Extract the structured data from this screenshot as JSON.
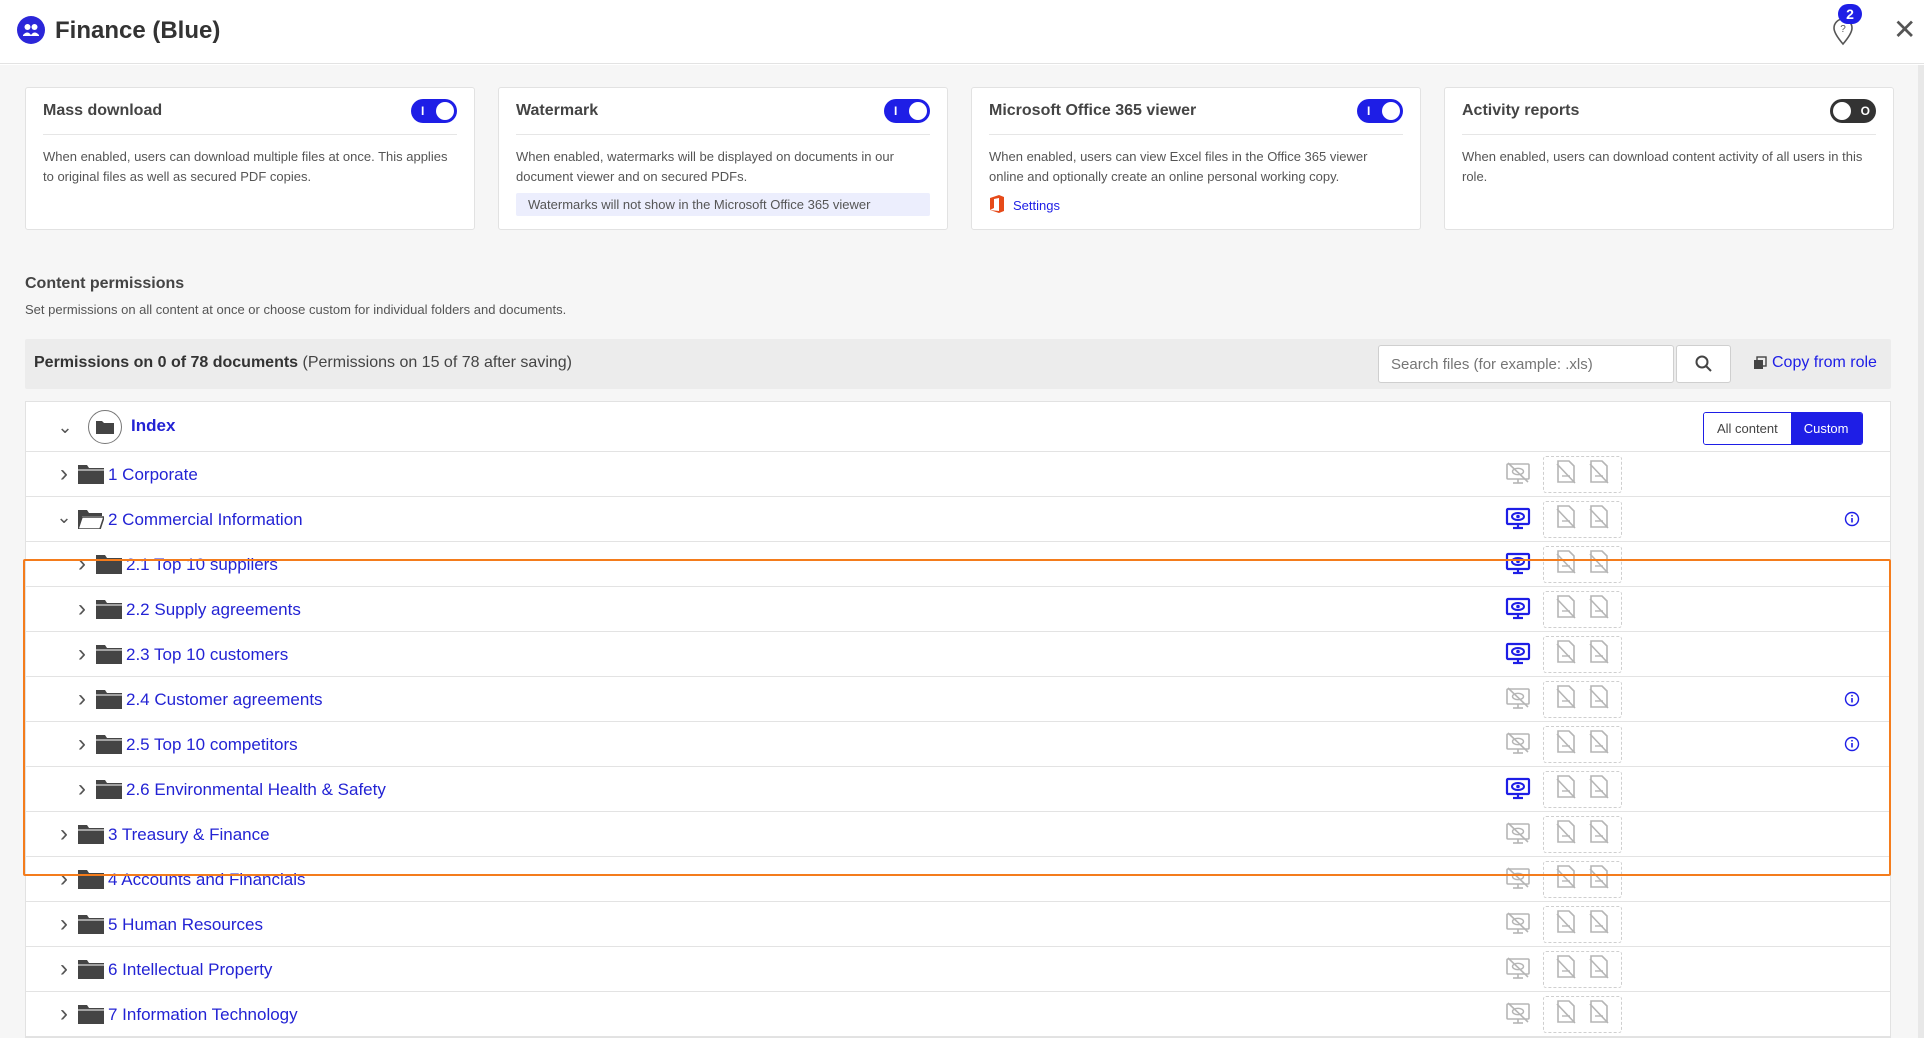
{
  "header": {
    "title": "Finance (Blue)",
    "help_badge": "2",
    "help_icon": "location-help-icon",
    "close_icon": "close-icon"
  },
  "cards": [
    {
      "title": "Mass download",
      "toggle": "on",
      "toggle_mark": "I",
      "description": "When enabled, users can download multiple files at once. This applies to original files as well as secured PDF copies."
    },
    {
      "title": "Watermark",
      "toggle": "on",
      "toggle_mark": "I",
      "description": "When enabled, watermarks will be displayed on documents in our document viewer and on secured PDFs.",
      "note": "Watermarks will not show in the Microsoft Office 365 viewer"
    },
    {
      "title": "Microsoft Office 365 viewer",
      "toggle": "on",
      "toggle_mark": "I",
      "description": "When enabled, users can view Excel files in the Office 365 viewer online and optionally create an online personal working copy.",
      "settings_label": "Settings"
    },
    {
      "title": "Activity reports",
      "toggle": "off",
      "toggle_mark": "O",
      "description": "When enabled, users can download content activity of all users in this role."
    }
  ],
  "content_permissions": {
    "title": "Content permissions",
    "subtitle": "Set permissions on all content at once or choose custom for individual folders and documents.",
    "count_bold": "Permissions on 0 of 78 documents",
    "count_rest": "(Permissions on 15 of 78 after saving)",
    "search_placeholder": "Search files (for example: .xls)",
    "copy_from_role": "Copy from role"
  },
  "tree": {
    "root": {
      "label": "Index",
      "seg_all": "All content",
      "seg_custom": "Custom"
    },
    "rows": [
      {
        "label": "1 Corporate",
        "level": 1,
        "expanded": false,
        "viewer": false,
        "info": false
      },
      {
        "label": "2 Commercial Information",
        "level": 1,
        "expanded": true,
        "viewer": true,
        "info": true
      },
      {
        "label": "2.1 Top 10 suppliers",
        "level": 2,
        "expanded": false,
        "viewer": true,
        "info": false
      },
      {
        "label": "2.2 Supply agreements",
        "level": 2,
        "expanded": false,
        "viewer": true,
        "info": false
      },
      {
        "label": "2.3 Top 10 customers",
        "level": 2,
        "expanded": false,
        "viewer": true,
        "info": false
      },
      {
        "label": "2.4 Customer agreements",
        "level": 2,
        "expanded": false,
        "viewer": false,
        "info": true
      },
      {
        "label": "2.5 Top 10 competitors",
        "level": 2,
        "expanded": false,
        "viewer": false,
        "info": true
      },
      {
        "label": "2.6 Environmental Health & Safety",
        "level": 2,
        "expanded": false,
        "viewer": true,
        "info": false
      },
      {
        "label": "3 Treasury & Finance",
        "level": 1,
        "expanded": false,
        "viewer": false,
        "info": false
      },
      {
        "label": "4 Accounts and Financials",
        "level": 1,
        "expanded": false,
        "viewer": false,
        "info": false
      },
      {
        "label": "5 Human Resources",
        "level": 1,
        "expanded": false,
        "viewer": false,
        "info": false
      },
      {
        "label": "6 Intellectual Property",
        "level": 1,
        "expanded": false,
        "viewer": false,
        "info": false
      },
      {
        "label": "7 Information Technology",
        "level": 1,
        "expanded": false,
        "viewer": false,
        "info": false
      }
    ]
  },
  "colors": {
    "accent": "#1e1ee6",
    "link": "#2323d4",
    "highlight": "#f47c1c",
    "muted_icon": "#b5b5b5"
  }
}
